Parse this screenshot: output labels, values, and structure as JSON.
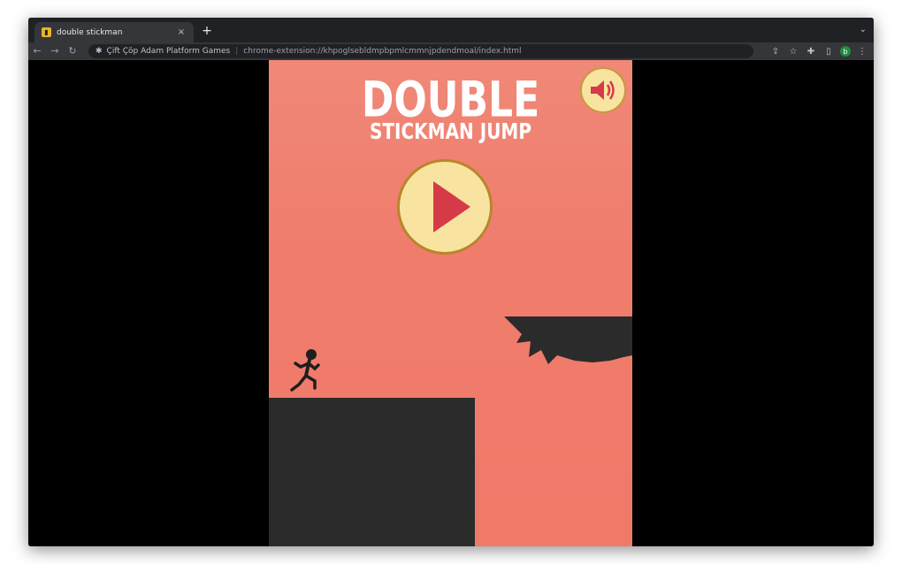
{
  "browser": {
    "tab_title": "double stickman",
    "tab_close": "×",
    "new_tab": "+",
    "tab_menu": "⌄",
    "back": "←",
    "forward": "→",
    "reload": "↻",
    "site_name": "Çift Çöp Adam Platform Games",
    "separator": "|",
    "url": "chrome-extension://khpoglsebldmpbpmlcmmnjpdendmoal/index.html",
    "avatar_letter": "b"
  },
  "game": {
    "title_line1": "DOUBLE",
    "title_line2": "STICKMAN JUMP",
    "colors": {
      "background": "#f07c6c",
      "button_fill": "#f8e4a0",
      "play_triangle": "#d63a48",
      "platform": "#2b2b2b",
      "title": "#ffffff"
    },
    "icons": {
      "sound": "speaker-icon",
      "play": "play-icon",
      "character": "stickman-runner",
      "obstacle": "spiked-saw"
    }
  }
}
